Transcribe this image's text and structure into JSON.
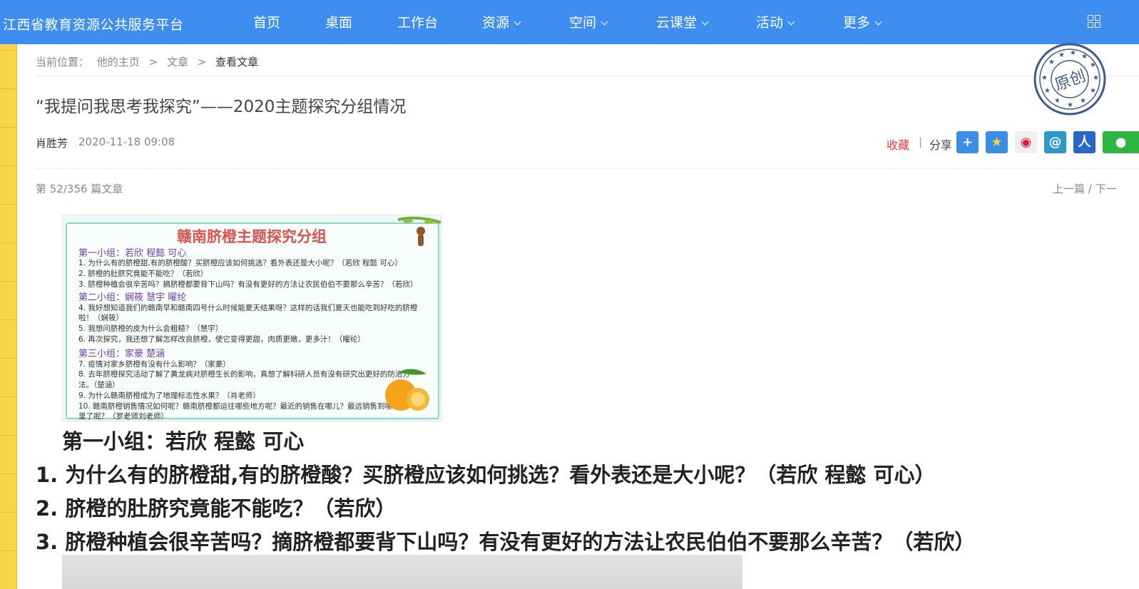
{
  "header": {
    "site_title": "江西省教育资源公共服务平台",
    "nav": [
      {
        "label": "首页",
        "dropdown": false
      },
      {
        "label": "桌面",
        "dropdown": false
      },
      {
        "label": "工作台",
        "dropdown": false
      },
      {
        "label": "资源",
        "dropdown": true
      },
      {
        "label": "空间",
        "dropdown": true
      },
      {
        "label": "云课堂",
        "dropdown": true
      },
      {
        "label": "活动",
        "dropdown": true
      },
      {
        "label": "更多",
        "dropdown": true
      }
    ],
    "apps_icon": "grid-icon",
    "bg_color": "#3d8ef0"
  },
  "breadcrumb": {
    "prefix": "当前位置：",
    "items": [
      "他的主页",
      "文章",
      "查看文章"
    ],
    "separator": ">"
  },
  "article": {
    "title": "“我提问我思考我探究”——2020主题探究分组情况",
    "author": "肖胜芳",
    "date": "2020-11-18 09:08",
    "collect_label": "收藏",
    "divider": "|",
    "share_label": "分享",
    "share_icons": [
      "plus-share-icon",
      "qzone-icon",
      "weibo-icon",
      "tencent-weibo-icon",
      "renren-icon",
      "wechat-icon"
    ],
    "stamp_text": "原创",
    "count_text": "第 52/356 篇文章",
    "prev_next": "上一篇 / 下一"
  },
  "image": {
    "title": "赣南脐橙主题探究分组",
    "lines": [
      {
        "text": "第一小组：若欣  程懿  可心",
        "group": true
      },
      {
        "text": "1. 为什么有的脐橙甜,有的脐橙酸？买脐橙应该如何挑选？看外表还是大小呢？（若欣  程懿  可心）",
        "group": false
      },
      {
        "text": "2. 脐橙的肚脐究竟能不能吃？（若欣）",
        "group": false
      },
      {
        "text": "3. 脐橙种植会很辛苦吗？摘脐橙都要背下山吗？有没有更好的方法让农民伯伯不要那么辛苦？（若欣）",
        "group": false
      },
      {
        "text": "第二小组：娴筱    慧宇    曜纶",
        "group": true
      },
      {
        "text": "4. 我好想知道我们的赣南早和赣南四号什么时候能夏天结果呀？这样的话我们夏天也能吃到好吃的脐橙",
        "group": false
      },
      {
        "text": "啦！（娴筱）",
        "group": false
      },
      {
        "text": "5. 我想问脐橙的皮为什么会粗糙？（慧宇）",
        "group": false
      },
      {
        "text": "6. 再次探究，我还想了解怎样改良脐橙，使它变得更甜，肉质更嫩，更多汁！（曜纶）",
        "group": false
      },
      {
        "text": "第三小组：家豪  楚涵",
        "group": true
      },
      {
        "text": "7. 疫情对家乡脐橙有没有什么影响？（家豪）",
        "group": false
      },
      {
        "text": "8. 去年脐橙探究活动了解了黄龙病对脐橙生长的影响，真想了解科研人员有没有研究出更好的防治方",
        "group": false
      },
      {
        "text": "法。（楚涵）",
        "group": false
      },
      {
        "text": "9. 为什么赣南脐橙成为了地理标志性水果？（肖老师）",
        "group": false
      },
      {
        "text": "10.     赣南脐橙销售情况如何呢？赣南脐橙都运往哪些地方呢？最近的销售在哪儿？最远销售到哪",
        "group": false
      },
      {
        "text": "里了呢？（罗老师刘老师）",
        "group": false
      }
    ]
  },
  "content": [
    {
      "number": "",
      "text": "第一小组：若欣  程懿  可心"
    },
    {
      "number": "1.",
      "text": "为什么有的脐橙甜,有的脐橙酸？买脐橙应该如何挑选？看外表还是大小呢？（若欣  程懿  可心）"
    },
    {
      "number": "2.",
      "text": "脐橙的肚脐究竟能不能吃？（若欣）"
    },
    {
      "number": "3.",
      "text": "脐橙种植会很辛苦吗？摘脐橙都要背下山吗？有没有更好的方法让农民伯伯不要那么辛苦？（若欣）"
    }
  ],
  "colors": {
    "collect": "#e23a3a",
    "left_stripe": "#f9d44a"
  }
}
